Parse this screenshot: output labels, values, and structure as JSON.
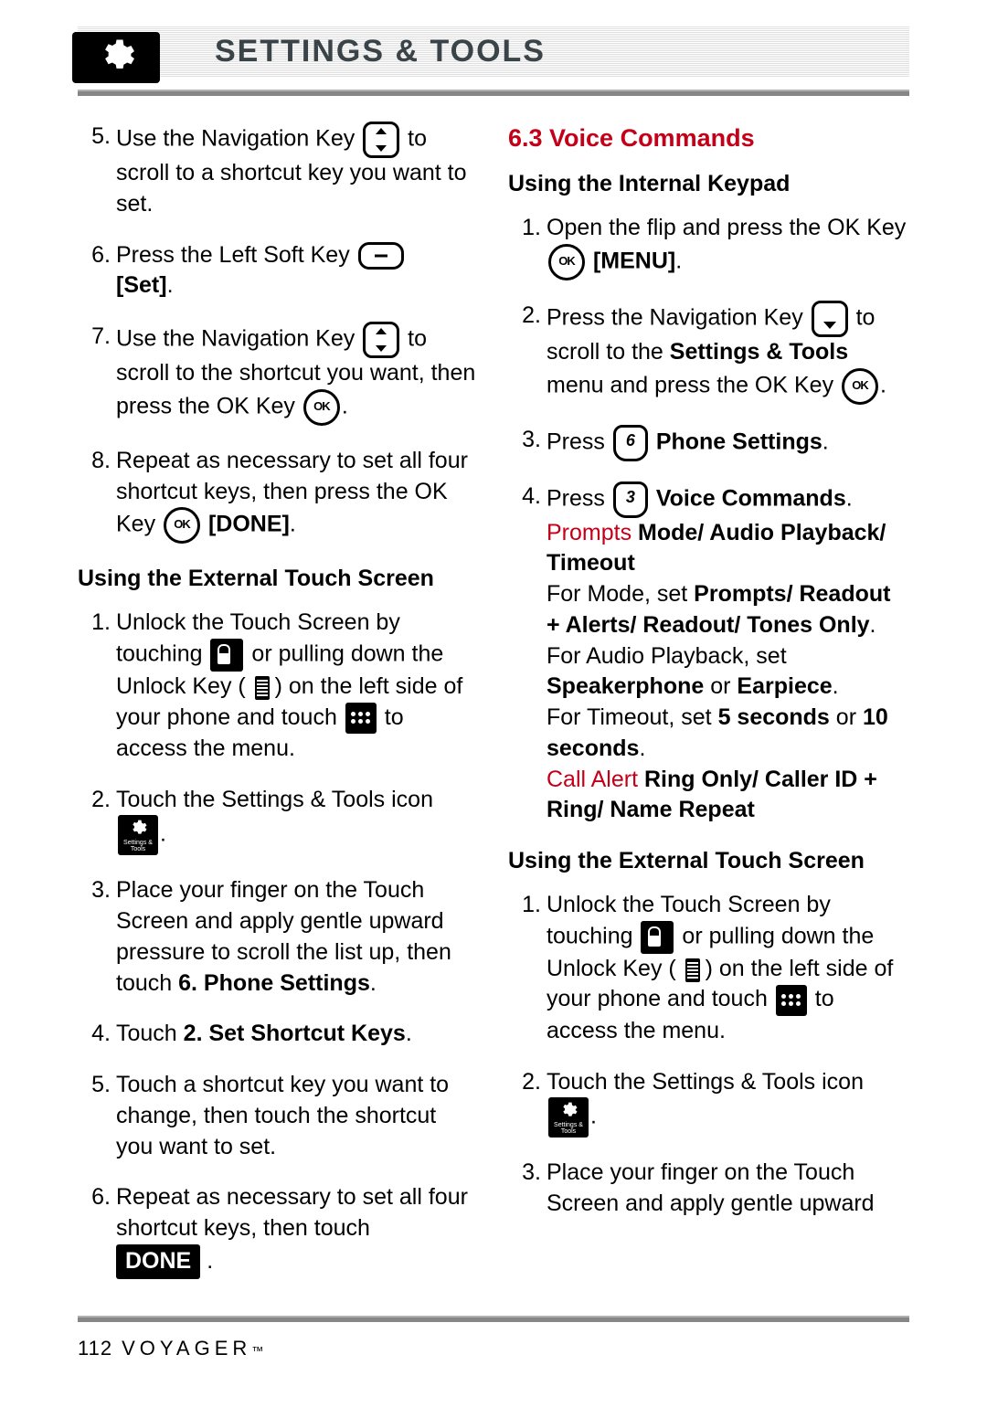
{
  "header": {
    "title": "SETTINGS & TOOLS"
  },
  "left": {
    "step5": {
      "num": "5.",
      "t1": "Use the Navigation Key ",
      "t2": " to scroll to a shortcut key you want to set."
    },
    "step6": {
      "num": "6.",
      "t1": "Press the Left Soft Key ",
      "set": "[Set]",
      "t2": "."
    },
    "step7": {
      "num": "7.",
      "t1": "Use the Navigation Key ",
      "t2": " to scroll to the shortcut you want, then press the OK Key ",
      "t3": "."
    },
    "step8": {
      "num": "8.",
      "t1": "Repeat as necessary to set all four shortcut keys, then press the OK Key ",
      "done": "[DONE]",
      "t2": "."
    },
    "sub_ext": "Using the External Touch Screen",
    "e1": {
      "num": "1.",
      "t1": "Unlock the Touch Screen by touching ",
      "t2": " or pulling down the Unlock Key ( ",
      "t3": " ) on the left side of your phone and touch ",
      "t4": " to access the menu."
    },
    "e2": {
      "num": "2.",
      "t1": "Touch the Settings & Tools icon ",
      "t2": "."
    },
    "e3": {
      "num": "3.",
      "t1": "Place your finger on the Touch Screen and apply gentle upward pressure to scroll the list up, then touch ",
      "b": "6. Phone Settings",
      "t2": "."
    },
    "e4": {
      "num": "4.",
      "t1": "Touch ",
      "b": "2. Set Shortcut Keys",
      "t2": "."
    },
    "e5": {
      "num": "5.",
      "t1": "Touch a shortcut key you want to change, then touch the shortcut you want to set."
    },
    "e6": {
      "num": "6.",
      "t1": "Repeat as necessary to set all four shortcut keys, then touch ",
      "done": "DONE",
      "t2": " ."
    }
  },
  "right": {
    "section": "6.3 Voice Commands",
    "sub_int": "Using the Internal Keypad",
    "i1": {
      "num": "1.",
      "t1": "Open the flip and press the OK Key ",
      "b": "[MENU]",
      "t2": "."
    },
    "i2": {
      "num": "2.",
      "t1": "Press the Navigation Key ",
      "t2": " to scroll to the ",
      "b": "Settings & Tools",
      "t3": " menu and press the OK Key ",
      "t4": "."
    },
    "i3": {
      "num": "3.",
      "t1": "Press ",
      "b": "Phone Settings",
      "t2": "."
    },
    "i4": {
      "num": "4.",
      "t1": "Press ",
      "b1": "Voice Commands",
      "t2": ".",
      "r1": "Prompts ",
      "b2": "Mode/ Audio Playback/ Timeout",
      "t3": "For Mode, set ",
      "b3": "Prompts/ Readout + Alerts/ Readout/ Tones Only",
      "t4": ".",
      "t5": "For Audio Playback, set ",
      "b4": "Speakerphone",
      "t6": " or ",
      "b5": "Earpiece",
      "t7": ".",
      "t8": "For Timeout, set ",
      "b6": "5 seconds",
      "t9": " or ",
      "b7": "10 seconds",
      "t10": ".",
      "r2": "Call Alert ",
      "b8": "Ring Only/ Caller ID + Ring/ Name Repeat"
    },
    "sub_ext": "Using the External Touch Screen",
    "x1": {
      "num": "1.",
      "t1": "Unlock the Touch Screen by touching ",
      "t2": " or pulling down the Unlock Key ( ",
      "t3": " ) on the left side of your phone and touch ",
      "t4": " to access the menu."
    },
    "x2": {
      "num": "2.",
      "t1": "Touch the Settings & Tools icon ",
      "t2": "."
    },
    "x3": {
      "num": "3.",
      "t1": "Place your finger on the Touch Screen and apply gentle upward"
    }
  },
  "footer": {
    "page": "112",
    "brand": "VOYAGER",
    "tm": "™"
  }
}
